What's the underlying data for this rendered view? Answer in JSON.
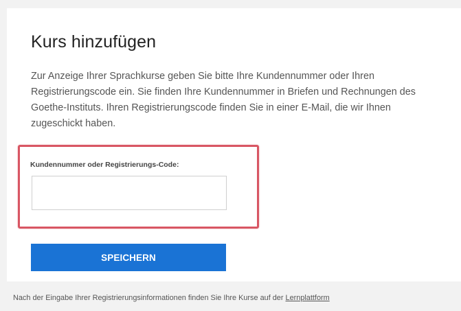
{
  "dialog": {
    "title": "Kurs hinzufügen",
    "description": "Zur Anzeige Ihrer Sprachkurse geben Sie bitte Ihre Kundennummer oder Ihren Registrierungscode ein. Sie finden Ihre Kundennummer in Briefen und Rechnungen des Goethe-Instituts. Ihren Registrierungscode finden Sie in einer E-Mail, die wir Ihnen zugeschickt haben.",
    "field_label": "Kundennummer oder Registrierungs-Code:",
    "field_value": "",
    "save_label": "SPEICHERN"
  },
  "footer": {
    "text": "Nach der Eingabe Ihrer Registrierungsinformationen finden Sie Ihre Kurse auf der ",
    "link_label": "Lernplattform"
  },
  "colors": {
    "page_background": "#f2f2f2",
    "card_background": "#ffffff",
    "highlight_border": "#d85663",
    "button_background": "#1a73d5",
    "button_text": "#ffffff"
  }
}
